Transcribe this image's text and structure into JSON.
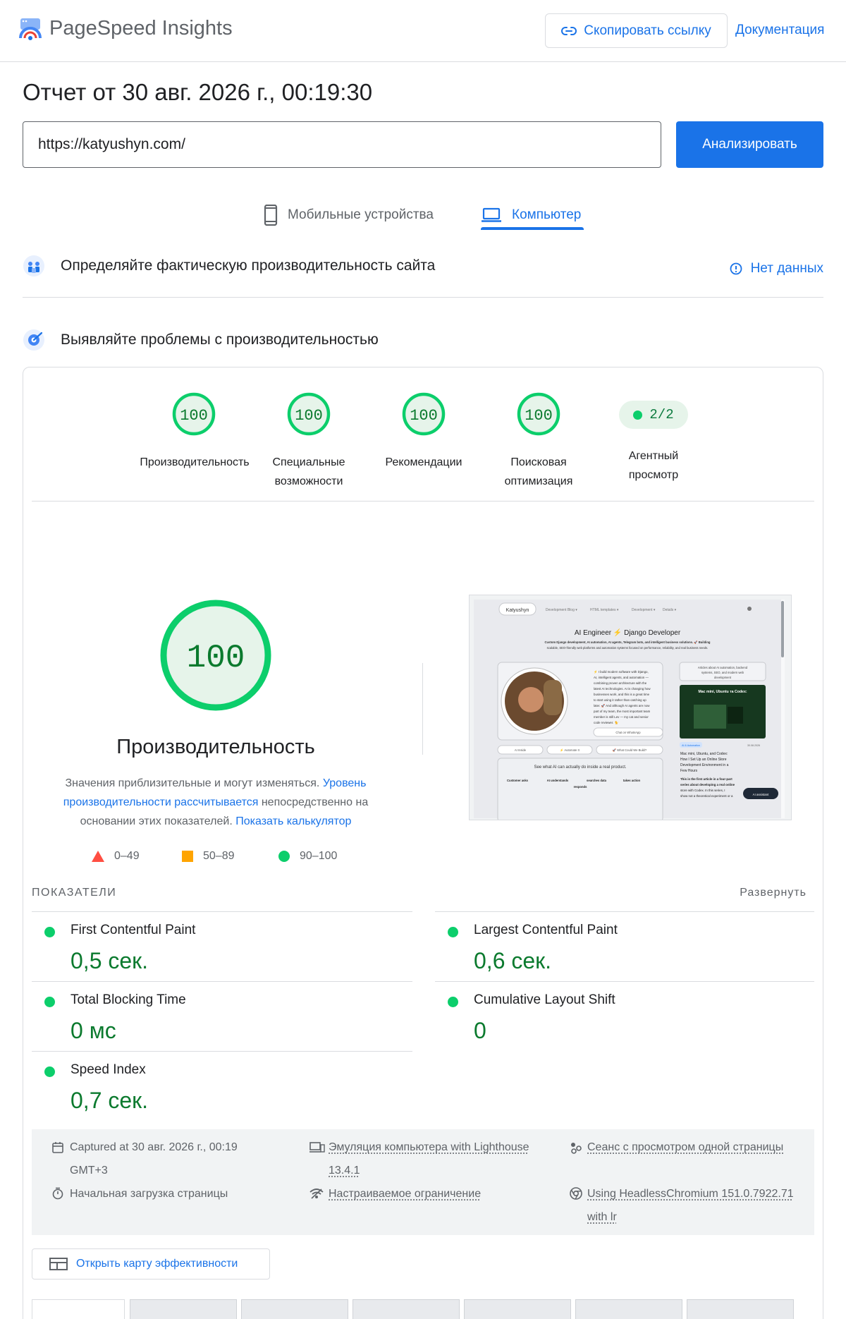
{
  "header": {
    "app_title": "PageSpeed Insights",
    "copy_link": "Скопировать ссылку",
    "docs": "Документация"
  },
  "report": {
    "title": "Отчет от 30 авг. 2026 г., 00:19:30",
    "url": "https://katyushyn.com/",
    "analyze": "Анализировать"
  },
  "tabs": [
    {
      "label": "Мобильные устройства",
      "active": false
    },
    {
      "label": "Компьютер",
      "active": true
    }
  ],
  "field": {
    "title": "Определяйте фактическую производительность сайта",
    "status": "Нет данных"
  },
  "lab": {
    "title": "Выявляйте проблемы с производительностью"
  },
  "scores": [
    {
      "value": "100",
      "label_1": "Производительность",
      "label_2": ""
    },
    {
      "value": "100",
      "label_1": "Специальные",
      "label_2": "возможности"
    },
    {
      "value": "100",
      "label_1": "Рекомендации",
      "label_2": ""
    },
    {
      "value": "100",
      "label_1": "Поисковая",
      "label_2": "оптимизация"
    }
  ],
  "agent": {
    "value": "2/2",
    "label_1": "Агентный",
    "label_2": "просмотр"
  },
  "performance": {
    "score": "100",
    "label": "Производительность",
    "desc_1": "Значения приблизительные и могут изменяться. ",
    "desc_link": "Уровень производительности рассчитывается",
    "desc_2": " непосредственно на основании этих показателей. ",
    "calc_link": "Показать калькулятор"
  },
  "legend": {
    "poor": "0–49",
    "average": "50–89",
    "good": "90–100"
  },
  "screenshot": {
    "brand": "Katyushyn",
    "menu_1": "Development Blog ▾",
    "menu_2": "HTML templates ▾",
    "menu_3": "Development ▾",
    "menu_4": "Details ▾",
    "headline": "AI Engineer ⚡ Django Developer",
    "sub_1": "Custom Django development, AI automation, AI agents, Telegram bots, and intelligent business solutions. 🚀 Building",
    "sub_2": "scalable, SEO-friendly web platforms and automation systems focused on performance, reliability, and real business needs.",
    "bio_1": "⚡ I build modern software with Django,",
    "bio_2": "AI, intelligent agents, and automation —",
    "bio_3": "combining proven architecture with the",
    "bio_4": "latest AI technologies. AI is changing how",
    "bio_5": "businesses work, and this is a great time",
    "bio_6": "to start using it rather than catching up",
    "bio_7": "later. 🚀 And although AI agents are now",
    "bio_8": "part of my team, the most important team",
    "bio_9": "member is still Lev — my cat and senior",
    "bio_10": "code reviewer. 🐈",
    "chat": "Chat on WhatsApp",
    "ai_inside": "AI Inside",
    "automate": "⚡ Automate It",
    "what_build": "🚀 What Could We Build?",
    "see_ai": "See what AI can actually do inside a real product.",
    "flow_1": "Customer asks",
    "flow_2": "AI understands",
    "flow_3": "searches data",
    "flow_4": "takes action",
    "flow_5": "responds",
    "side_1": "Articles about AI automation, backend",
    "side_2": "systems, SEO, and modern web",
    "side_3": "development",
    "card_title": "Mac mini, Ubuntu та Codex:",
    "tag": "AI & Automation",
    "date": "30.08.2026",
    "art_1": "Mac mini, Ubuntu, and Codex:",
    "art_2": "How I Set Up an Online Store",
    "art_3": "Development Environment in a",
    "art_4": "Few Hours",
    "art_5": "This is the first article in a four-part",
    "art_6": "series about developing a real online",
    "art_7": "store with Codex. In this series, I",
    "art_8": "show not a theoretical experiment or a",
    "assistant": "AI assistant"
  },
  "metrics": {
    "header": "ПОКАЗАТЕЛИ",
    "expand": "Развернуть",
    "items": [
      {
        "name": "First Contentful Paint",
        "value": "0,5 сек."
      },
      {
        "name": "Largest Contentful Paint",
        "value": "0,6 сек."
      },
      {
        "name": "Total Blocking Time",
        "value": "0 мс"
      },
      {
        "name": "Cumulative Layout Shift",
        "value": "0"
      },
      {
        "name": "Speed Index",
        "value": "0,7 сек."
      }
    ]
  },
  "runtime": {
    "captured_1": "Captured at 30 авг. 2026 г., 00:19",
    "captured_2": "GMT+3",
    "load": "Начальная загрузка страницы",
    "emulation_1": "Эмуляция компьютера with Lighthouse",
    "emulation_2": "13.4.1",
    "throttling": "Настраиваемое ограничение",
    "session": "Сеанс с просмотром одной страницы",
    "browser_1": "Using HeadlessChromium 151.0.7922.71",
    "browser_2": "with lr"
  },
  "treemap": "Открыть карту эффективности",
  "colors": {
    "accent": "#1a73e8",
    "pass": "#0cce6b",
    "pass_text": "#0b7a2e",
    "average": "#ffa400",
    "fail": "#ff4e42"
  }
}
